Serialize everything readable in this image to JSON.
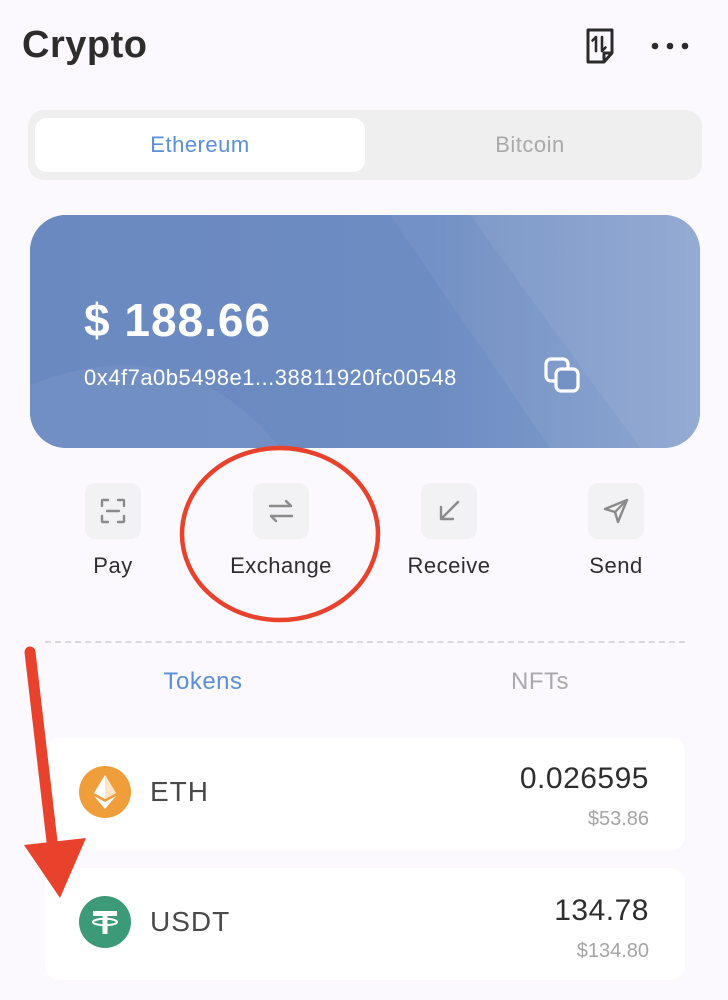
{
  "header": {
    "title": "Crypto",
    "transactions_icon": "transactions-icon",
    "more_icon": "more-horizontal-icon"
  },
  "network_tabs": [
    {
      "label": "Ethereum",
      "selected": true
    },
    {
      "label": "Bitcoin",
      "selected": false
    }
  ],
  "wallet": {
    "balance": "$ 188.66",
    "address": "0x4f7a0b5498e1...38811920fc00548",
    "copy_icon": "copy-icon"
  },
  "actions": [
    {
      "label": "Pay",
      "icon": "scan-icon"
    },
    {
      "label": "Exchange",
      "icon": "swap-arrows-icon"
    },
    {
      "label": "Receive",
      "icon": "arrow-down-left-icon"
    },
    {
      "label": "Send",
      "icon": "send-icon"
    }
  ],
  "asset_tabs": [
    {
      "label": "Tokens",
      "selected": true
    },
    {
      "label": "NFTs",
      "selected": false
    }
  ],
  "tokens": [
    {
      "symbol": "ETH",
      "amount": "0.026595",
      "usd": "$53.86",
      "icon": "ethereum-icon"
    },
    {
      "symbol": "USDT",
      "amount": "134.78",
      "usd": "$134.80",
      "icon": "tether-icon"
    }
  ],
  "colors": {
    "accent": "#5b8fd9",
    "card": "#6e8dc1",
    "eth": "#f09e3c",
    "usdt": "#3d9a78",
    "annotation_red": "#e8422c"
  }
}
